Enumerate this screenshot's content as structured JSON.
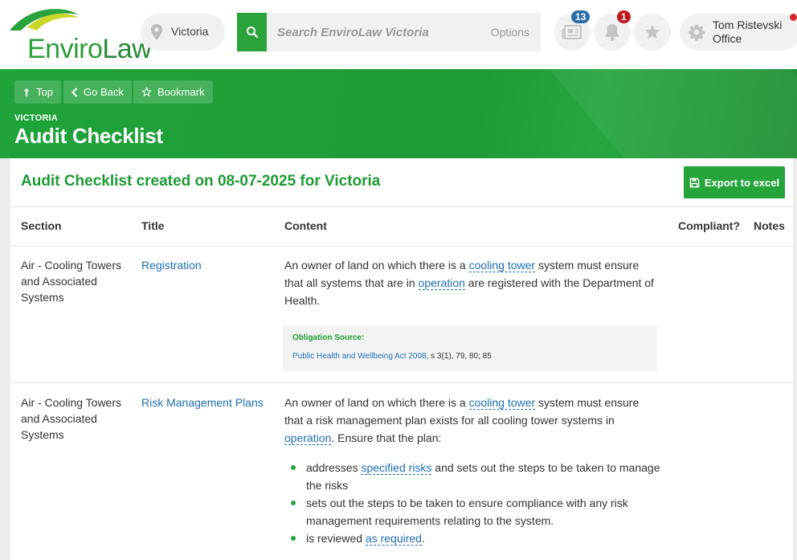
{
  "brand": {
    "name_part1": "Enviro",
    "name_part2": "Law"
  },
  "location": {
    "label": "Victoria",
    "icon": "map-pin-icon"
  },
  "search": {
    "placeholder": "Search EnviroLaw Victoria",
    "options_label": "Options",
    "icon": "search-icon"
  },
  "header_icons": {
    "news": {
      "icon": "newspaper-icon",
      "badge": "13"
    },
    "notifications": {
      "icon": "bell-icon",
      "badge": "1"
    },
    "favorites": {
      "icon": "star-icon"
    }
  },
  "user": {
    "name": "Tom Ristevski",
    "role": "Office",
    "icon": "gear-icon"
  },
  "banner": {
    "buttons": {
      "top": "Top",
      "back": "Go Back",
      "bookmark": "Bookmark"
    },
    "breadcrumb": "VICTORIA",
    "title": "Audit Checklist"
  },
  "checklist": {
    "heading": "Audit Checklist created on 08-07-2025 for Victoria",
    "export_label": "Export to excel",
    "columns": {
      "section": "Section",
      "title": "Title",
      "content": "Content",
      "compliant": "Compliant?",
      "notes": "Notes"
    },
    "rows": [
      {
        "section": "Air - Cooling Towers and Associated Systems",
        "title": "Registration",
        "content": {
          "t1": "An owner of land on which there is a ",
          "link1": "cooling tower",
          "t2": " system must ensure that all systems that are in ",
          "link2": "operation",
          "t3": " are registered with the Department of Health."
        },
        "obligation": {
          "label": "Obligation Source:",
          "act": "Public Health and Wellbeing Act 2008",
          "sections": ", s 3(1), 79, 80; 85"
        }
      },
      {
        "section": "Air - Cooling Towers and Associated Systems",
        "title": "Risk Management Plans",
        "content": {
          "t1": "An owner of land on which there is a ",
          "link1": "cooling tower",
          "t2": " system must ensure that a risk management plan exists for all cooling tower systems in ",
          "link2": "operation",
          "t3": ". Ensure that the plan:"
        },
        "bullets": {
          "b1_pre": "addresses ",
          "b1_link": "specified risks",
          "b1_post": " and sets out the steps to be taken to manage the risks",
          "b2": "sets out the steps to be taken to ensure compliance with any risk management requirements relating to the system.",
          "b3_pre": "is reviewed ",
          "b3_link": "as required",
          "b3_post": "."
        }
      }
    ]
  },
  "colors": {
    "brand_green": "#25a43b",
    "link_blue": "#1d6fb4",
    "badge_blue": "#2b6da8",
    "badge_red": "#c0171e"
  }
}
